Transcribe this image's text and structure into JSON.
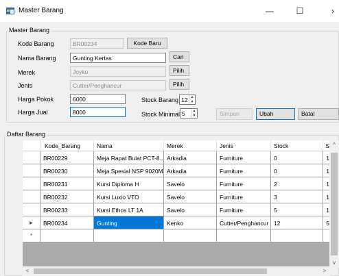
{
  "window": {
    "title": "Master Barang",
    "minimize_glyph": "—",
    "maximize_glyph": "☐",
    "close_glyph": "›"
  },
  "master_group": {
    "label": "Master Barang",
    "kode_label": "Kode Barang",
    "kode_value": "BR00234",
    "kode_baru_button": "Kode Baru",
    "nama_label": "Nama Barang",
    "nama_value": "Gunting Kertas",
    "cari_button": "Cari",
    "merek_label": "Merek",
    "merek_value": "Joyko",
    "pilih_merek_button": "Pilih",
    "jenis_label": "Jenis",
    "jenis_value": "Cutter/Penghancur",
    "pilih_jenis_button": "Pilih",
    "harga_pokok_label": "Harga Pokok",
    "harga_pokok_value": "6000",
    "harga_jual_label": "Harga Jual",
    "harga_jual_value": "8000",
    "stock_barang_label": "Stock Barang",
    "stock_barang_value": "12",
    "stock_minimal_label": "Stock Minimal",
    "stock_minimal_value": "5",
    "simpan_button": "Simpan",
    "ubah_button": "Ubah",
    "batal_button": "Batal"
  },
  "daftar_group": {
    "label": "Daftar Barang",
    "columns": [
      "Kode_Barang",
      "Nama",
      "Merek",
      "Jenis",
      "Stock",
      "S"
    ],
    "rows": [
      {
        "marker": "",
        "cells": [
          "BR00229",
          "Meja Rapat Bulat PCT-8...",
          "Arkadia",
          "Furniture",
          "0",
          "1"
        ]
      },
      {
        "marker": "",
        "cells": [
          "BR00230",
          "Meja Spesial NSP 9020M",
          "Arkadia",
          "Furniture",
          "0",
          "1"
        ]
      },
      {
        "marker": "",
        "cells": [
          "BR00231",
          "Kursi Diploma H",
          "Savelo",
          "Furniture",
          "2",
          "1"
        ]
      },
      {
        "marker": "",
        "cells": [
          "BR00232",
          "Kursi Luxio VTO",
          "Savelo",
          "Furniture",
          "3",
          "1"
        ]
      },
      {
        "marker": "",
        "cells": [
          "BR00233",
          "Kursi Ethos LT 1A",
          "Savelo",
          "Furniture",
          "5",
          "1"
        ]
      },
      {
        "marker": "▸",
        "cells": [
          "BR00234",
          "Gunting",
          "Kenko",
          "Cutter/Penghancur",
          "12",
          "5"
        ]
      },
      {
        "marker": "*",
        "cells": [
          "",
          "",
          "",
          "",
          "",
          ""
        ]
      }
    ],
    "scroll_up": "^",
    "scroll_down": "v",
    "scroll_left": "<",
    "scroll_right": ">"
  }
}
